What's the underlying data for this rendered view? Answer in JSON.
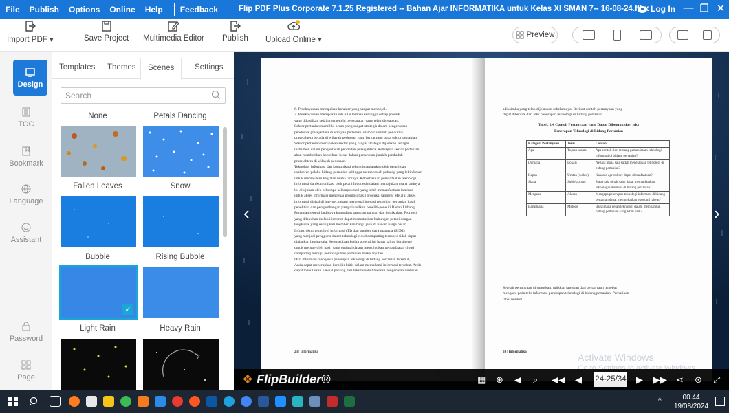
{
  "menu": {
    "items": [
      "File",
      "Publish",
      "Options",
      "Online",
      "Help"
    ],
    "feedback": "Feedback"
  },
  "window": {
    "title": "Flip PDF Plus Corporate 7.1.25 Registered -- Bahan Ajar INFORMATIKA untuk Kelas XI SMAN 7-- 16-08-24.flbx",
    "login": "Log In"
  },
  "toolbar": {
    "import": "Import PDF ▾",
    "save": "Save Project",
    "multimedia": "Multimedia Editor",
    "publish": "Publish",
    "upload": "Upload Online ▾",
    "preview": "Preview"
  },
  "nav": [
    {
      "label": "Design",
      "icon": "design-icon"
    },
    {
      "label": "TOC",
      "icon": "toc-icon"
    },
    {
      "label": "Bookmark",
      "icon": "bookmark-icon"
    },
    {
      "label": "Language",
      "icon": "globe-icon"
    },
    {
      "label": "Assistant",
      "icon": "chat-icon"
    },
    {
      "label": "Password",
      "icon": "lock-icon"
    },
    {
      "label": "Page",
      "icon": "page-icon"
    }
  ],
  "panel": {
    "tabs": [
      "Templates",
      "Themes",
      "Scenes",
      "Settings"
    ],
    "search_placeholder": "Search",
    "scenes": [
      "None",
      "Petals Dancing",
      "Fallen Leaves",
      "Snow",
      "Bubble",
      "Rising Bubble",
      "Light Rain",
      "Heavy Rain"
    ]
  },
  "book": {
    "left_lines": [
      "6.  Perekayasaan merupakan karakter yang sangat menonjol.",
      "7.  Perekayasaan merupakan inti nilai tambah sehingga setiap produk",
      "     yang dihasilkan selalu memenuhi persyaratan yang telah ditetapkan.",
      "Sektor pertanian memiliki peran yang sangat strategis dalam pengentasan",
      "penduduk prasejahtera di wilayah pedesaan. Hampir seluruh penduduk",
      "prasejahtera berada di wilayah pedesaan yang bergantung pada sektor pertanian.",
      "Sektor pertanian merupakan sektor yang sangat strategis dijadikan sebagai",
      "instrumen dalam pengentasan penduduk prasejahtera. Kemajuan sektor pertanian",
      "akan memberikan kontribusi besar dalam penurunan jumlah penduduk",
      "prasejahtera di wilayah pedesaan.",
      "Teknologi informasi dan komunikasi telah dimanfaatkan oleh petani dan",
      "usahawan pelaku bidang pertanian sehingga memperoleh peluang yang lebih besar",
      "untuk memajukan kegiatan usaha tanınya. Keberhasilan pemanfaatan teknologi",
      "informasi dan komunikasi oleh petani Indonesia dalam memajukan usaha taninya",
      "itu ditujukan oleh beberapa kelompok tani yang telah memanfaatkan internet",
      "untuk akses informasi mengenai promosi hasil produksi taninya. Melalui akses",
      "informasi digital di internet, petani mengenal inovasi teknologi pertanian hasil",
      "penelitian dan pengembangan yang dihasilkan peneliti-peneliti Badan Litbang",
      "Pertanian seperti budidaya komoditas tanaman pangan dan hortikultur. Promosi",
      "yang dilakukan melalui internet dapat memutuskan hubungan petani dengan",
      "tengkulak yang sering kali memberikan harga jauh di bawah harga pasar.",
      "Infrastruktur teknologi informasi (TI) dan sumber daya manusia (SDM)",
      "yang menjadi pengguna dalam teknologi cloud computing ternanya tidak dapat",
      "diabaikan begitu saja. Ketersediaan kedua potensi ini harus saling bersinergi",
      "untuk memperoleh hasil yang optimal dalam mewujudkan pemanfaatan cloud",
      "computing menuju pembangunan pertanian berkelanjutan.",
      "Dari informasi mengenai penerapan teknologi di bidang pertanian tersebut,",
      "Anda dapat menerapkan berpikir kritis dalam memahami informasi tersebut. Anda",
      "dapat menuliskan hal-hal penting dari teks tersebut melalui pengenalan rumusan"
    ],
    "left_footer": "23 | Informatika",
    "right_intro": [
      "adiksimba yang telah dijelaskan sebelumnya. Berikut contoh pertanyaan yang",
      "dapat dibentuk dari teks penerapan teknologi di bidang pertanian."
    ],
    "table_title": "Tabel. 2.4 Contoh Pertanyaan yang Dapat Dibentuk dari teks",
    "table_subtitle": "Penerapan Teknologi di Bidang Pertanian",
    "table_header": [
      "Kategori Pertanyaan",
      "Jenis",
      "Contoh"
    ],
    "table_rows": [
      [
        "Apa",
        "Tujuan utama",
        "Apa contoh riset tentang pemanfaatan teknologi informasi di bidang pertanian?"
      ],
      [
        "Di mana",
        "Lokasi",
        "Negara mana saja sudah menerapkan teknologi di bidang pertanian?"
      ],
      [
        "Kapan",
        "Urutan (waktu)",
        "Kapan e-agriculture dapat dimanfaatkan?"
      ],
      [
        "Siapa",
        "Subjek/orang",
        "Siapa saja pihak yang dapat memanfaatkan teknologi informasi di bidang pertanian?"
      ],
      [
        "Mengapa",
        "Alasan",
        "Mengapa penerapan teknologi informasi di bidang pertanian dapat meningkatkan ekonomi rakyat?"
      ],
      [
        "Bagaimana",
        "Metode",
        "Bagaimana peran teknologi dalam membangun bidang pertanian yang lebih baik?"
      ]
    ],
    "right_outro": [
      "Setelah pertanyaan dirumuskan, tuliskan jawaban dari pertanyaan tersebut",
      "mengacu pada teks informasi penerapan teknologi di bidang pertanian. Perhatikan",
      "tabel berikut."
    ],
    "right_footer": "24 | Informatika",
    "watermark": "Activate Windows",
    "watermark_sub": "Go to Settings to activate Windows.",
    "brand": "FlipBuilder®",
    "page_indicator": "24-25/34"
  },
  "taskbar": {
    "time": "00.44",
    "date": "19/08/2024"
  }
}
